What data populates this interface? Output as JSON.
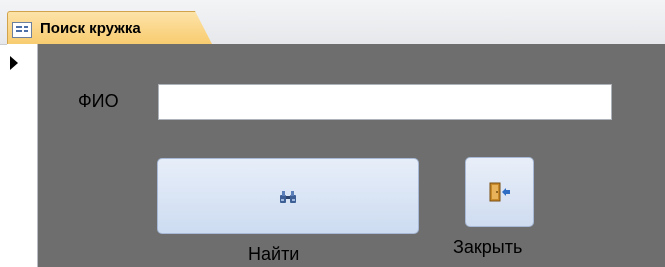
{
  "tab": {
    "icon": "form-icon",
    "title": "Поиск кружка"
  },
  "form": {
    "fio_label": "ФИО",
    "fio_value": "",
    "find_button": {
      "icon": "binoculars-icon",
      "label": "Найти"
    },
    "close_button": {
      "icon": "exit-door-icon",
      "label": "Закрыть"
    }
  },
  "colors": {
    "tab_bg": "#f8cb6e",
    "detail_bg": "#6e6e6e",
    "button_bg": "#dbe6f6"
  }
}
